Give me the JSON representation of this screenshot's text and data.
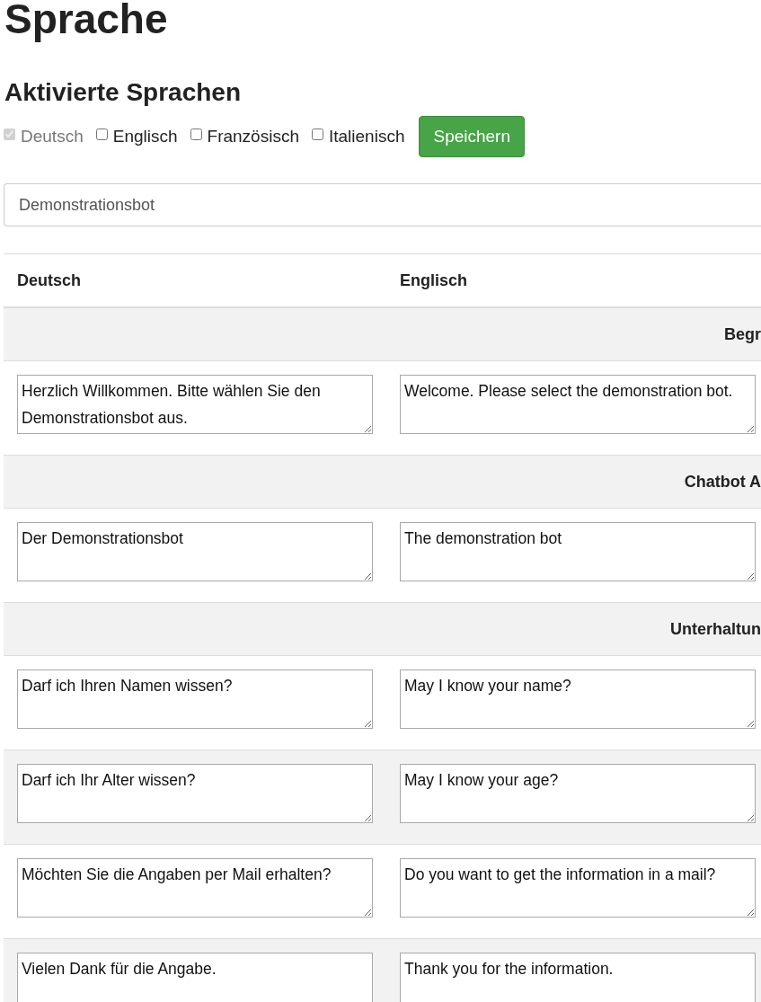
{
  "title": "Sprache",
  "languages": {
    "heading": "Aktivierte Sprachen",
    "options": [
      {
        "label": "Deutsch",
        "checked": true,
        "disabled": true
      },
      {
        "label": "Englisch",
        "checked": false,
        "disabled": false
      },
      {
        "label": "Französisch",
        "checked": false,
        "disabled": false
      },
      {
        "label": "Italienisch",
        "checked": false,
        "disabled": false
      }
    ],
    "save_button": "Speichern"
  },
  "bot_select": {
    "value": "Demonstrationsbot"
  },
  "table": {
    "columns": [
      "Deutsch",
      "Englisch"
    ],
    "rows": [
      {
        "kind": "section",
        "label": "Begr"
      },
      {
        "kind": "entry",
        "cells": [
          "Herzlich Willkommen. Bitte wählen Sie den Demonstrationsbot aus.",
          "Welcome. Please select the demonstration bot."
        ]
      },
      {
        "kind": "section",
        "label": "Chatbot A"
      },
      {
        "kind": "entry",
        "cells": [
          "Der Demonstrationsbot",
          "The demonstration bot"
        ]
      },
      {
        "kind": "section",
        "label": "Unterhaltun"
      },
      {
        "kind": "entry",
        "cells": [
          "Darf ich Ihren Namen wissen?",
          "May I know your name?"
        ]
      },
      {
        "kind": "entry",
        "cells": [
          "Darf ich Ihr Alter wissen?",
          "May I know your age?"
        ]
      },
      {
        "kind": "entry",
        "cells": [
          "Möchten Sie die Angaben per Mail erhalten?",
          "Do you want to get the information in a mail?"
        ]
      },
      {
        "kind": "entry",
        "cells": [
          "Vielen Dank für die Angabe.",
          "Thank you for the information."
        ]
      }
    ]
  }
}
